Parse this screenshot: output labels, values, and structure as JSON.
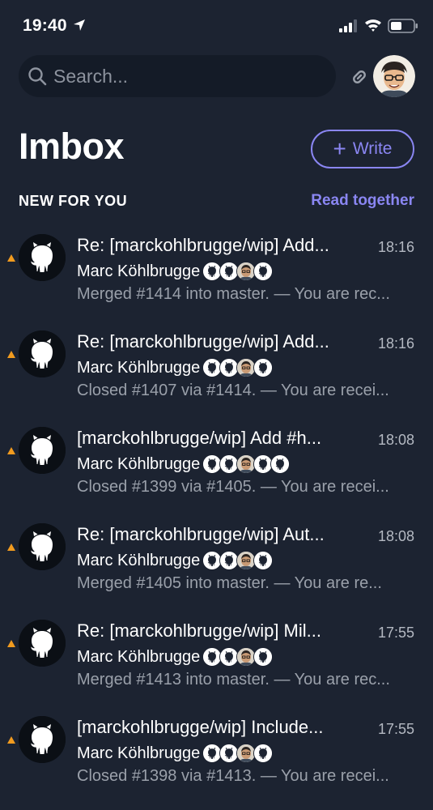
{
  "status_bar": {
    "time": "19:40"
  },
  "search": {
    "placeholder": "Search..."
  },
  "header": {
    "title": "Imbox",
    "write_label": "Write",
    "section_label": "NEW FOR YOU",
    "read_together_label": "Read together"
  },
  "colors": {
    "background": "#1c2331",
    "accent": "#8a86f2",
    "unread_marker": "#f19b1f"
  },
  "messages": [
    {
      "subject": "Re: [marckohlbrugge/wip] Add...",
      "time": "18:16",
      "sender": "Marc Köhlbrugge",
      "snippet": "Merged #1414 into master. — You are rec...",
      "participants": [
        "github-icon",
        "github-icon",
        "person-avatar",
        "github-icon"
      ]
    },
    {
      "subject": "Re: [marckohlbrugge/wip] Add...",
      "time": "18:16",
      "sender": "Marc Köhlbrugge",
      "snippet": "Closed #1407 via #1414. — You are recei...",
      "participants": [
        "github-icon",
        "github-icon",
        "person-avatar",
        "github-icon"
      ]
    },
    {
      "subject": "[marckohlbrugge/wip] Add #h...",
      "time": "18:08",
      "sender": "Marc Köhlbrugge",
      "snippet": "Closed #1399 via #1405. — You are recei...",
      "participants": [
        "github-icon",
        "github-icon",
        "person-avatar",
        "github-icon",
        "github-icon"
      ]
    },
    {
      "subject": "Re: [marckohlbrugge/wip] Aut...",
      "time": "18:08",
      "sender": "Marc Köhlbrugge",
      "snippet": "Merged #1405 into master. — You are re...",
      "participants": [
        "github-icon",
        "github-icon",
        "person-avatar",
        "github-icon"
      ]
    },
    {
      "subject": "Re: [marckohlbrugge/wip] Mil...",
      "time": "17:55",
      "sender": "Marc Köhlbrugge",
      "snippet": "Merged #1413 into master. — You are rec...",
      "participants": [
        "github-icon",
        "github-icon",
        "person-avatar",
        "github-icon"
      ]
    },
    {
      "subject": "[marckohlbrugge/wip] Include...",
      "time": "17:55",
      "sender": "Marc Köhlbrugge",
      "snippet": "Closed #1398 via #1413. — You are recei...",
      "participants": [
        "github-icon",
        "github-icon",
        "person-avatar",
        "github-icon"
      ]
    }
  ]
}
